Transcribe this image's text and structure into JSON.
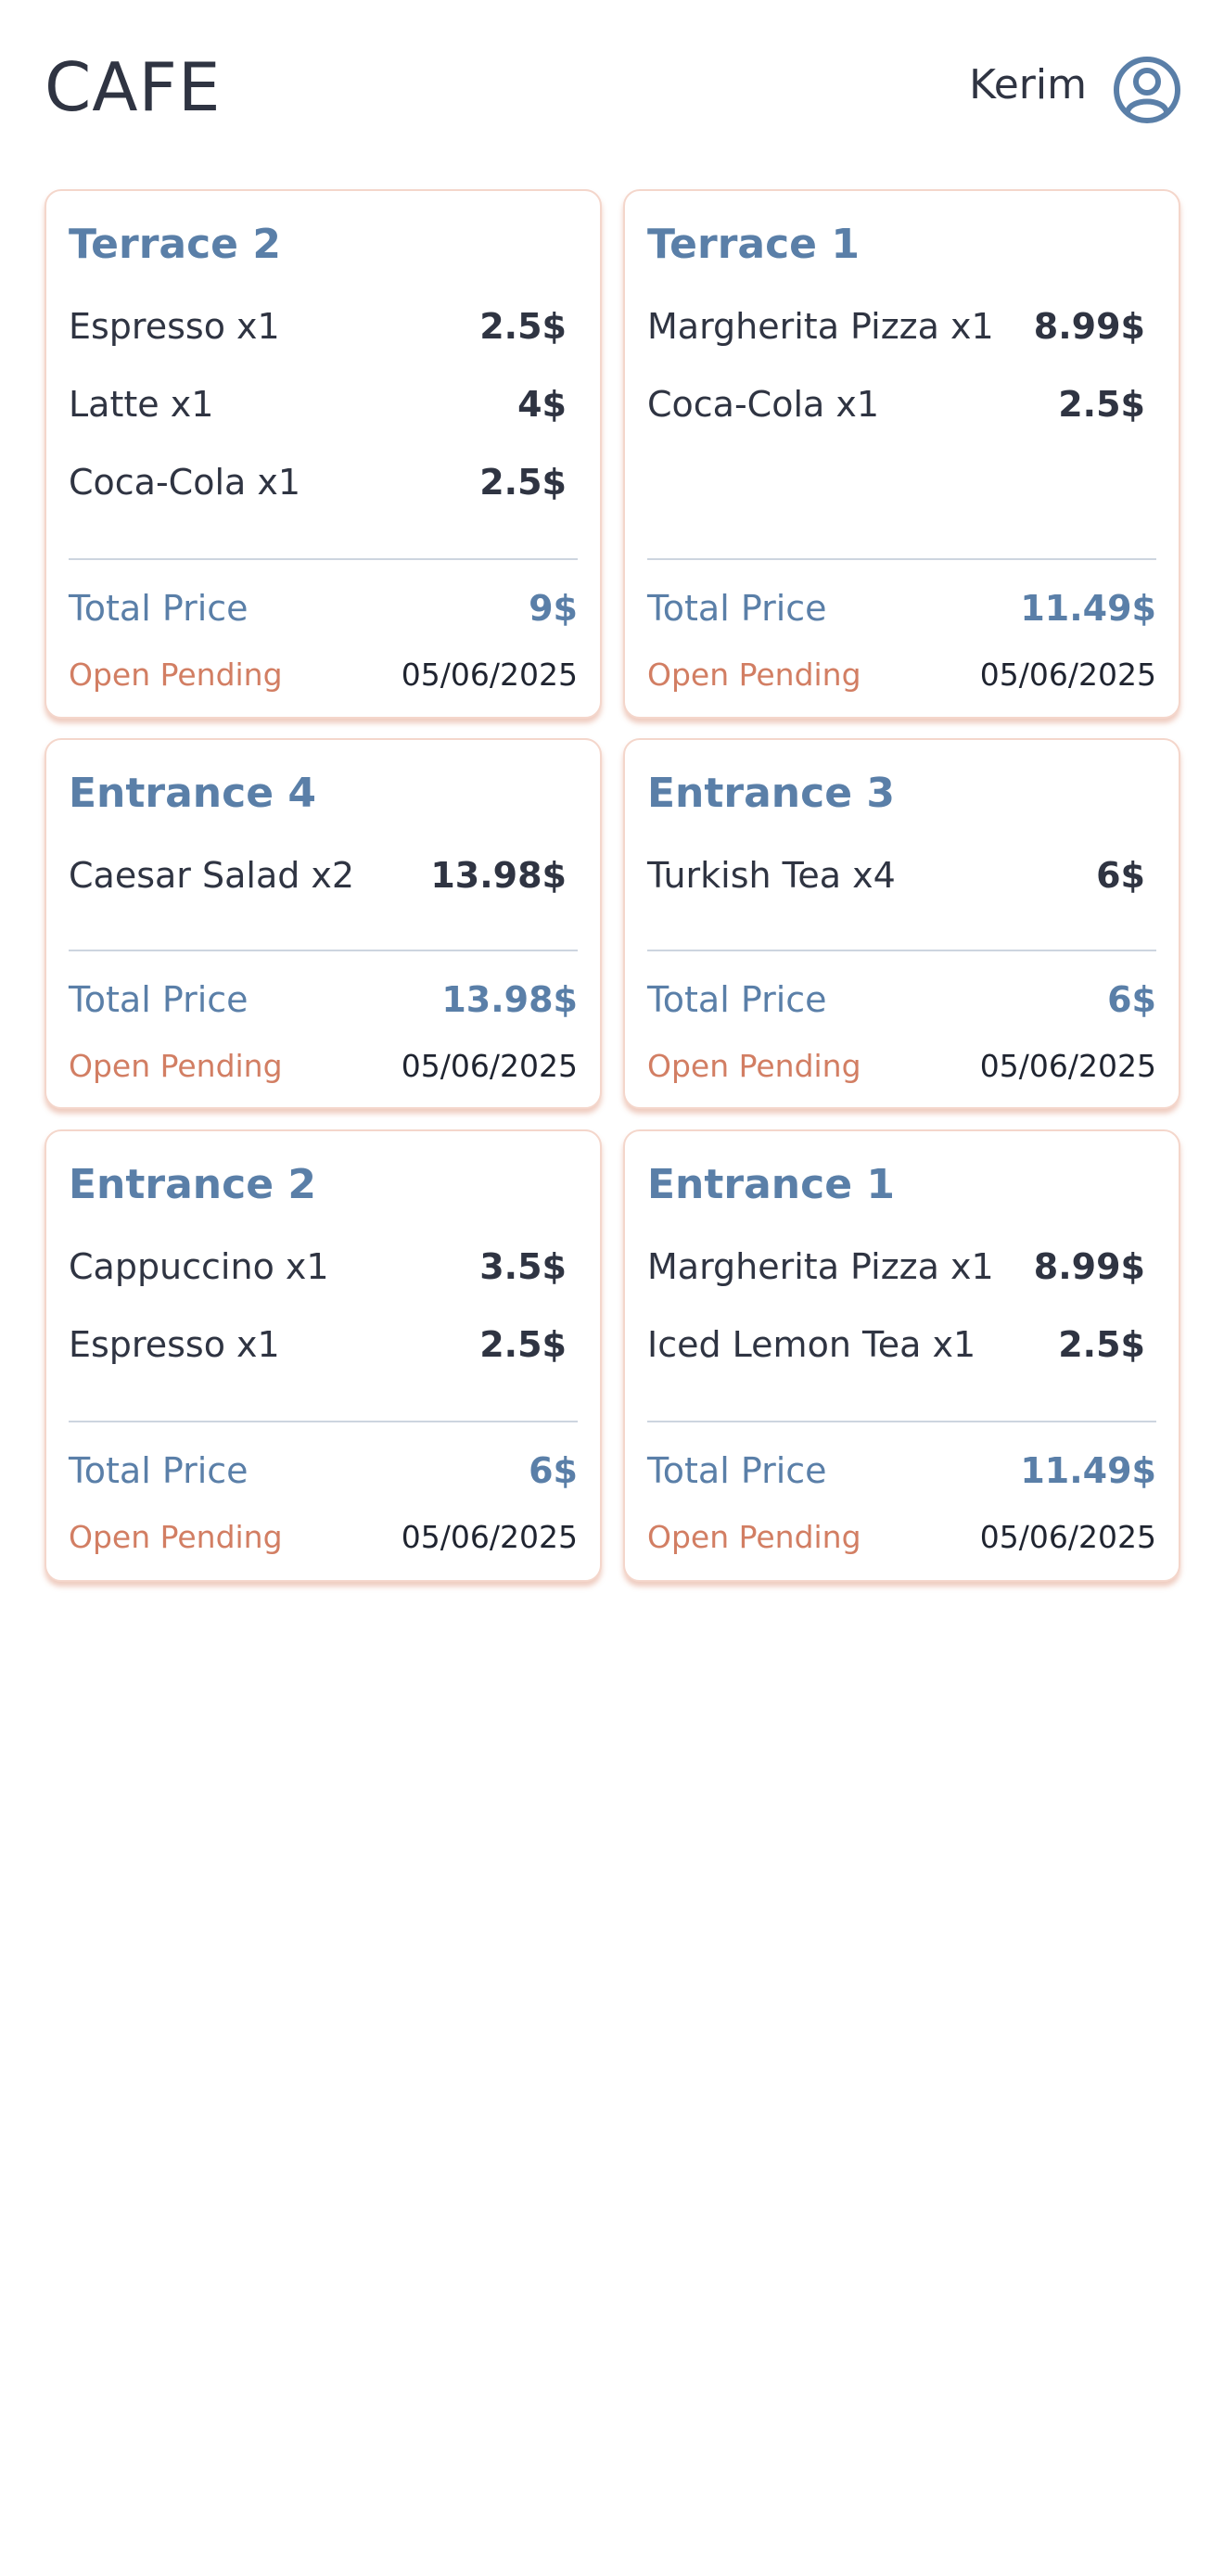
{
  "header": {
    "title": "CAFE",
    "user_name": "Kerim",
    "avatar_icon": "user-circle-icon"
  },
  "colors": {
    "accent_blue": "#5a7fa8",
    "status_orange": "#d27e63",
    "card_border": "#f4d6cb",
    "text_dark": "#2f3442"
  },
  "orders": [
    {
      "table": "Terrace 2",
      "items": [
        {
          "name": "Espresso x1",
          "price": "2.5$"
        },
        {
          "name": "Latte x1",
          "price": "4$"
        },
        {
          "name": "Coca-Cola x1",
          "price": "2.5$"
        }
      ],
      "total_label": "Total Price",
      "total": "9$",
      "status": "Open Pending",
      "date": "05/06/2025"
    },
    {
      "table": "Terrace 1",
      "items": [
        {
          "name": "Margherita Pizza x1",
          "price": "8.99$"
        },
        {
          "name": "Coca-Cola x1",
          "price": "2.5$"
        }
      ],
      "total_label": "Total Price",
      "total": "11.49$",
      "status": "Open Pending",
      "date": "05/06/2025"
    },
    {
      "table": "Entrance 4",
      "items": [
        {
          "name": "Caesar Salad x2",
          "price": "13.98$"
        }
      ],
      "total_label": "Total Price",
      "total": "13.98$",
      "status": "Open Pending",
      "date": "05/06/2025"
    },
    {
      "table": "Entrance 3",
      "items": [
        {
          "name": "Turkish Tea x4",
          "price": "6$"
        }
      ],
      "total_label": "Total Price",
      "total": "6$",
      "status": "Open Pending",
      "date": "05/06/2025"
    },
    {
      "table": "Entrance 2",
      "items": [
        {
          "name": "Cappuccino x1",
          "price": "3.5$"
        },
        {
          "name": "Espresso x1",
          "price": "2.5$"
        }
      ],
      "total_label": "Total Price",
      "total": "6$",
      "status": "Open Pending",
      "date": "05/06/2025"
    },
    {
      "table": "Entrance 1",
      "items": [
        {
          "name": "Margherita Pizza x1",
          "price": "8.99$"
        },
        {
          "name": "Iced Lemon Tea x1",
          "price": "2.5$"
        }
      ],
      "total_label": "Total Price",
      "total": "11.49$",
      "status": "Open Pending",
      "date": "05/06/2025"
    }
  ]
}
